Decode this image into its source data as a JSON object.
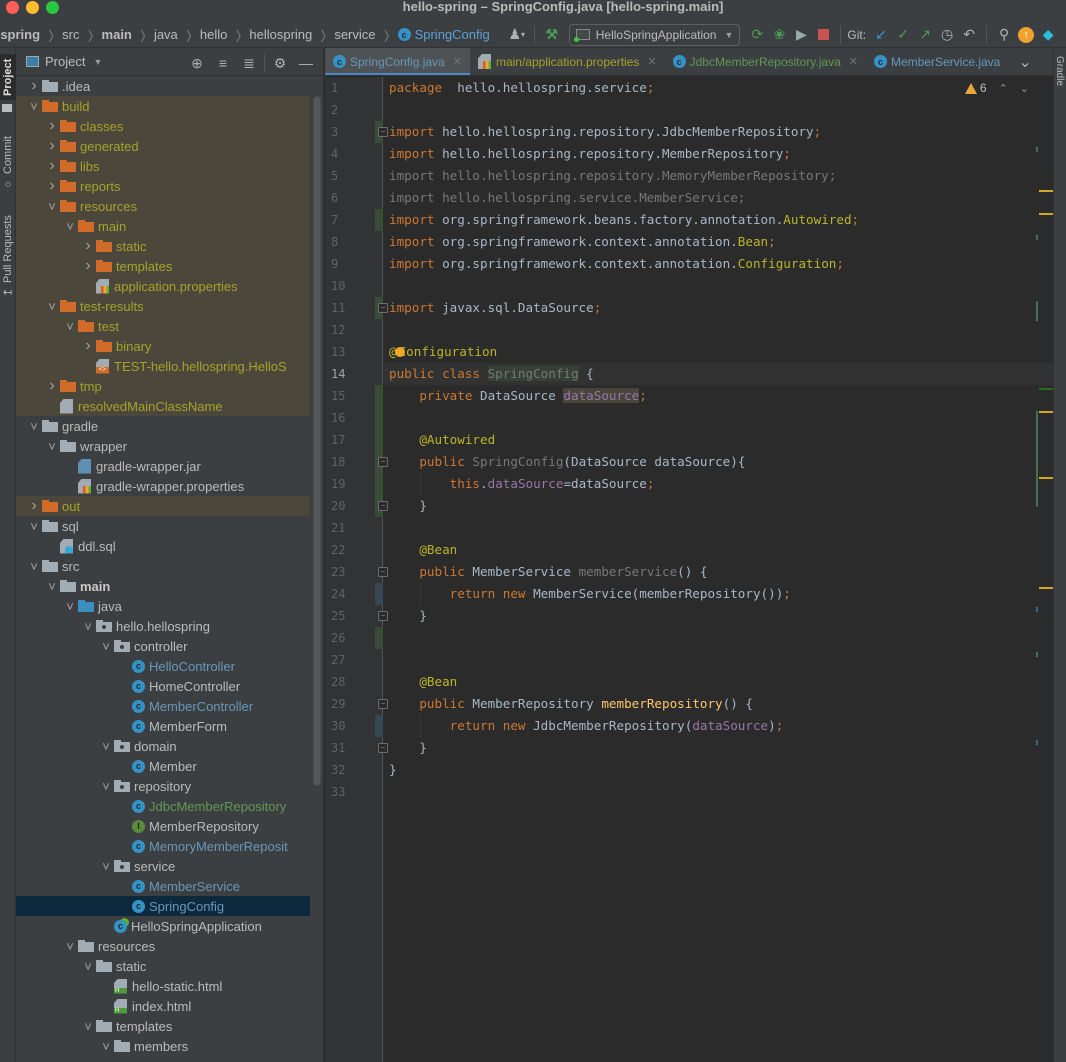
{
  "window": {
    "title": "hello-spring – SpringConfig.java [hello-spring.main]"
  },
  "breadcrumbs": [
    {
      "label": "-spring",
      "bold": true
    },
    {
      "label": "src"
    },
    {
      "label": "main",
      "bold": true
    },
    {
      "label": "java"
    },
    {
      "label": "hello"
    },
    {
      "label": "hellospring"
    },
    {
      "label": "service"
    },
    {
      "label": "SpringConfig",
      "icon": "class-icon"
    }
  ],
  "toolbar": {
    "run_config": "HelloSpringApplication",
    "git_label": "Git:",
    "icons": [
      "user-icon",
      "build-hammer-icon",
      "rerun-icon",
      "debug-icon",
      "coverage-icon",
      "stop-icon",
      "git-update-icon",
      "git-commit-icon",
      "git-push-icon",
      "history-icon",
      "rollback-icon",
      "search-icon",
      "update-icon",
      "toolbox-icon"
    ]
  },
  "tool_strip_left": [
    "Project",
    "Commit",
    "Pull Requests"
  ],
  "tool_strip_right": [
    "Gradle"
  ],
  "project_panel": {
    "title": "Project",
    "tree": [
      {
        "label": ".idea",
        "depth": 1,
        "type": "folder",
        "color": "gray",
        "expanded": false
      },
      {
        "label": "build",
        "depth": 1,
        "type": "folder",
        "color": "orange",
        "expanded": true,
        "excluded": true
      },
      {
        "label": "classes",
        "depth": 2,
        "type": "folder",
        "color": "orange",
        "expanded": false,
        "excluded": true
      },
      {
        "label": "generated",
        "depth": 2,
        "type": "folder",
        "color": "orange",
        "expanded": false,
        "excluded": true
      },
      {
        "label": "libs",
        "depth": 2,
        "type": "folder",
        "color": "orange",
        "expanded": false,
        "excluded": true
      },
      {
        "label": "reports",
        "depth": 2,
        "type": "folder",
        "color": "orange",
        "expanded": false,
        "excluded": true
      },
      {
        "label": "resources",
        "depth": 2,
        "type": "folder",
        "color": "orange",
        "expanded": true,
        "excluded": true
      },
      {
        "label": "main",
        "depth": 3,
        "type": "folder",
        "color": "orange",
        "expanded": true,
        "excluded": true
      },
      {
        "label": "static",
        "depth": 4,
        "type": "folder",
        "color": "orange",
        "expanded": false,
        "excluded": true
      },
      {
        "label": "templates",
        "depth": 4,
        "type": "folder",
        "color": "orange",
        "expanded": false,
        "excluded": true
      },
      {
        "label": "application.properties",
        "depth": 4,
        "type": "props",
        "excluded": true
      },
      {
        "label": "test-results",
        "depth": 2,
        "type": "folder",
        "color": "orange",
        "expanded": true,
        "excluded": true
      },
      {
        "label": "test",
        "depth": 3,
        "type": "folder",
        "color": "orange",
        "expanded": true,
        "excluded": true
      },
      {
        "label": "binary",
        "depth": 4,
        "type": "folder",
        "color": "orange",
        "expanded": false,
        "excluded": true
      },
      {
        "label": "TEST-hello.hellospring.HelloS",
        "depth": 4,
        "type": "xml",
        "excluded": true
      },
      {
        "label": "tmp",
        "depth": 2,
        "type": "folder",
        "color": "orange",
        "expanded": false,
        "excluded": true
      },
      {
        "label": "resolvedMainClassName",
        "depth": 2,
        "type": "text",
        "excluded": true
      },
      {
        "label": "gradle",
        "depth": 1,
        "type": "folder",
        "color": "gray",
        "expanded": true
      },
      {
        "label": "wrapper",
        "depth": 2,
        "type": "folder",
        "color": "gray",
        "expanded": true
      },
      {
        "label": "gradle-wrapper.jar",
        "depth": 3,
        "type": "jar"
      },
      {
        "label": "gradle-wrapper.properties",
        "depth": 3,
        "type": "props"
      },
      {
        "label": "out",
        "depth": 1,
        "type": "folder",
        "color": "orange",
        "expanded": false,
        "excluded": true
      },
      {
        "label": "sql",
        "depth": 1,
        "type": "folder",
        "color": "gray",
        "expanded": true
      },
      {
        "label": "ddl.sql",
        "depth": 2,
        "type": "sql"
      },
      {
        "label": "src",
        "depth": 1,
        "type": "folder",
        "color": "gray",
        "expanded": true
      },
      {
        "label": "main",
        "depth": 2,
        "type": "folder",
        "color": "gray",
        "expanded": true,
        "bold": true
      },
      {
        "label": "java",
        "depth": 3,
        "type": "folder",
        "color": "blue",
        "expanded": true
      },
      {
        "label": "hello.hellospring",
        "depth": 4,
        "type": "package",
        "expanded": true
      },
      {
        "label": "controller",
        "depth": 5,
        "type": "package",
        "expanded": true
      },
      {
        "label": "HelloController",
        "depth": 6,
        "type": "class",
        "status": "modified"
      },
      {
        "label": "HomeController",
        "depth": 6,
        "type": "class"
      },
      {
        "label": "MemberController",
        "depth": 6,
        "type": "class",
        "status": "modified"
      },
      {
        "label": "MemberForm",
        "depth": 6,
        "type": "class"
      },
      {
        "label": "domain",
        "depth": 5,
        "type": "package",
        "expanded": true
      },
      {
        "label": "Member",
        "depth": 6,
        "type": "class"
      },
      {
        "label": "repository",
        "depth": 5,
        "type": "package",
        "expanded": true
      },
      {
        "label": "JdbcMemberRepository",
        "depth": 6,
        "type": "class",
        "status": "added"
      },
      {
        "label": "MemberRepository",
        "depth": 6,
        "type": "interface"
      },
      {
        "label": "MemoryMemberReposit",
        "depth": 6,
        "type": "class",
        "status": "modified"
      },
      {
        "label": "service",
        "depth": 5,
        "type": "package",
        "expanded": true
      },
      {
        "label": "MemberService",
        "depth": 6,
        "type": "class",
        "status": "modified"
      },
      {
        "label": "SpringConfig",
        "depth": 6,
        "type": "class",
        "status": "modified",
        "selected": true
      },
      {
        "label": "HelloSpringApplication",
        "depth": 5,
        "type": "spring-class"
      },
      {
        "label": "resources",
        "depth": 3,
        "type": "resources",
        "expanded": true
      },
      {
        "label": "static",
        "depth": 4,
        "type": "folder",
        "color": "gray",
        "expanded": true
      },
      {
        "label": "hello-static.html",
        "depth": 5,
        "type": "html"
      },
      {
        "label": "index.html",
        "depth": 5,
        "type": "html"
      },
      {
        "label": "templates",
        "depth": 4,
        "type": "folder",
        "color": "gray",
        "expanded": true
      },
      {
        "label": "members",
        "depth": 5,
        "type": "folder",
        "color": "gray",
        "expanded": true
      }
    ]
  },
  "tabs": [
    {
      "label": "SpringConfig.java",
      "icon": "class-icon",
      "active": true,
      "closable": true
    },
    {
      "label": "main/application.properties",
      "icon": "properties-icon",
      "closable": true
    },
    {
      "label": "JdbcMemberRepository.java",
      "icon": "class-icon",
      "closable": true
    },
    {
      "label": "MemberService.java",
      "icon": "class-icon",
      "closable": false
    }
  ],
  "editor": {
    "warning_count": "6",
    "current_line": 14,
    "lines": [
      {
        "n": "1",
        "tokens": [
          [
            "kw",
            "package"
          ],
          [
            "",
            "  hello.hellospring.service"
          ],
          [
            "semi",
            ";"
          ]
        ]
      },
      {
        "n": "2",
        "tokens": []
      },
      {
        "n": "3",
        "tokens": [
          [
            "kw",
            "import"
          ],
          [
            "",
            " hello.hellospring.repository.JdbcMemberRepository"
          ],
          [
            "semi",
            ";"
          ]
        ]
      },
      {
        "n": "4",
        "tokens": [
          [
            "kw",
            "import"
          ],
          [
            "",
            " hello.hellospring.repository.MemberRepository"
          ],
          [
            "semi",
            ";"
          ]
        ]
      },
      {
        "n": "5",
        "tokens": [
          [
            "unused",
            "import hello.hellospring.repository.MemoryMemberRepository;"
          ]
        ]
      },
      {
        "n": "6",
        "tokens": [
          [
            "unused",
            "import hello.hellospring.service.MemberService;"
          ]
        ]
      },
      {
        "n": "7",
        "tokens": [
          [
            "kw",
            "import"
          ],
          [
            "",
            " org.springframework.beans.factory.annotation."
          ],
          [
            "ann",
            "Autowired"
          ],
          [
            "semi",
            ";"
          ]
        ]
      },
      {
        "n": "8",
        "tokens": [
          [
            "kw",
            "import"
          ],
          [
            "",
            " org.springframework.context.annotation."
          ],
          [
            "ann",
            "Bean"
          ],
          [
            "semi",
            ";"
          ]
        ]
      },
      {
        "n": "9",
        "tokens": [
          [
            "kw",
            "import"
          ],
          [
            "",
            " org.springframework.context.annotation."
          ],
          [
            "ann",
            "Configuration"
          ],
          [
            "semi",
            ";"
          ]
        ]
      },
      {
        "n": "10",
        "tokens": []
      },
      {
        "n": "11",
        "tokens": [
          [
            "kw",
            "import"
          ],
          [
            "",
            " javax.sql.DataSource"
          ],
          [
            "semi",
            ";"
          ]
        ]
      },
      {
        "n": "12",
        "tokens": []
      },
      {
        "n": "13",
        "tokens": [
          [
            "ann",
            "@"
          ],
          [
            "bulb",
            ""
          ],
          [
            "ann",
            "Configuration"
          ]
        ]
      },
      {
        "n": "14",
        "tokens": [
          [
            "kw",
            "public class "
          ],
          [
            "unused hl-class",
            "SpringConfig"
          ],
          [
            "",
            " {"
          ]
        ]
      },
      {
        "n": "15",
        "tokens": [
          [
            "",
            "    "
          ],
          [
            "kw",
            "private "
          ],
          [
            "",
            "DataSource "
          ],
          [
            "fld hl-field",
            "dataSource"
          ],
          [
            "semi",
            ";"
          ]
        ]
      },
      {
        "n": "16",
        "tokens": []
      },
      {
        "n": "17",
        "tokens": [
          [
            "",
            "    "
          ],
          [
            "ann",
            "@Autowired"
          ]
        ]
      },
      {
        "n": "18",
        "tokens": [
          [
            "",
            "    "
          ],
          [
            "kw",
            "public "
          ],
          [
            "unused",
            "SpringConfig"
          ],
          [
            "",
            "(DataSource dataSource){"
          ]
        ]
      },
      {
        "n": "19",
        "tokens": [
          [
            "",
            "        "
          ],
          [
            "kw",
            "this"
          ],
          [
            "",
            "."
          ],
          [
            "fld",
            "dataSource"
          ],
          [
            "",
            "=dataSource"
          ],
          [
            "semi",
            ";"
          ]
        ]
      },
      {
        "n": "20",
        "tokens": [
          [
            "",
            "    }"
          ]
        ]
      },
      {
        "n": "21",
        "tokens": []
      },
      {
        "n": "22",
        "tokens": [
          [
            "",
            "    "
          ],
          [
            "ann",
            "@Bean"
          ]
        ]
      },
      {
        "n": "23",
        "tokens": [
          [
            "",
            "    "
          ],
          [
            "kw",
            "public "
          ],
          [
            "",
            "MemberService "
          ],
          [
            "unused",
            "memberService"
          ],
          [
            "",
            "() {"
          ]
        ]
      },
      {
        "n": "24",
        "tokens": [
          [
            "",
            "        "
          ],
          [
            "kw",
            "return new "
          ],
          [
            "",
            "MemberService(memberRepository())"
          ],
          [
            "semi",
            ";"
          ]
        ]
      },
      {
        "n": "25",
        "tokens": [
          [
            "",
            "    }"
          ]
        ]
      },
      {
        "n": "26",
        "tokens": []
      },
      {
        "n": "27",
        "tokens": []
      },
      {
        "n": "28",
        "tokens": [
          [
            "",
            "    "
          ],
          [
            "ann",
            "@Bean"
          ]
        ]
      },
      {
        "n": "29",
        "tokens": [
          [
            "",
            "    "
          ],
          [
            "kw",
            "public "
          ],
          [
            "",
            "MemberRepository "
          ],
          [
            "mth",
            "memberRepository"
          ],
          [
            "",
            "() {"
          ]
        ]
      },
      {
        "n": "30",
        "tokens": [
          [
            "",
            "        "
          ],
          [
            "kw",
            "return new "
          ],
          [
            "",
            "JdbcMemberRepository("
          ],
          [
            "fld",
            "dataSource"
          ],
          [
            "",
            ")"
          ],
          [
            "semi",
            ";"
          ]
        ]
      },
      {
        "n": "31",
        "tokens": [
          [
            "",
            "    }"
          ]
        ]
      },
      {
        "n": "32",
        "tokens": [
          [
            "",
            "}"
          ]
        ]
      },
      {
        "n": "33",
        "tokens": []
      }
    ],
    "gutter_changes": [
      {
        "line": 3,
        "kind": "added"
      },
      {
        "line": 7,
        "kind": "added"
      },
      {
        "line": 11,
        "kind": "added"
      },
      {
        "line": 15,
        "kind": "added"
      },
      {
        "line": 16,
        "kind": "added"
      },
      {
        "line": 17,
        "kind": "added"
      },
      {
        "line": 18,
        "kind": "added"
      },
      {
        "line": 19,
        "kind": "added"
      },
      {
        "line": 20,
        "kind": "added"
      },
      {
        "line": 24,
        "kind": "modified"
      },
      {
        "line": 26,
        "kind": "added"
      },
      {
        "line": 30,
        "kind": "modified"
      }
    ],
    "folds": [
      {
        "line": 3,
        "kind": "start"
      },
      {
        "line": 11,
        "kind": "end"
      },
      {
        "line": 18,
        "kind": "start"
      },
      {
        "line": 20,
        "kind": "end"
      },
      {
        "line": 23,
        "kind": "start"
      },
      {
        "line": 25,
        "kind": "end"
      },
      {
        "line": 29,
        "kind": "start"
      },
      {
        "line": 31,
        "kind": "end"
      }
    ]
  }
}
